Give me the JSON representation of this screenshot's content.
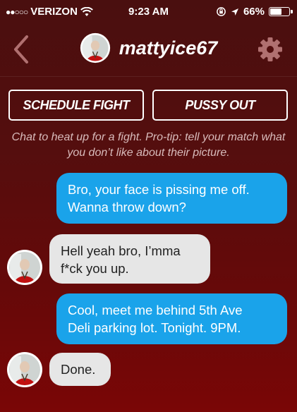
{
  "status": {
    "carrier": "VERIZON",
    "time": "9:23 AM",
    "battery": "66%",
    "battery_level": 0.66,
    "signal_dots": "●●○○○"
  },
  "nav": {
    "username": "mattyice67",
    "back_icon": "chevron-left-icon",
    "settings_icon": "gear-icon"
  },
  "actions": {
    "schedule_label": "SCHEDULE FIGHT",
    "pussy_out_label": "PUSSY OUT"
  },
  "tip": "Chat to heat up for a fight. Pro-tip: tell your match what you don’t like about their picture.",
  "messages": [
    {
      "from": "me",
      "text_line1": "Bro, your face is pissing me off.",
      "text_line2": "Wanna throw down?"
    },
    {
      "from": "them",
      "text_line1": "Hell yeah bro, I’mma",
      "text_line2": "f*ck you up."
    },
    {
      "from": "me",
      "text_line1": "Cool, meet me behind 5th Ave",
      "text_line2": "Deli parking lot. Tonight. 9PM."
    },
    {
      "from": "them",
      "text_line1": "Done.",
      "text_line2": ""
    }
  ],
  "colors": {
    "sent_bubble": "#1aa3ea",
    "received_bubble": "#e6e6e6",
    "background_top": "#4a0f0f",
    "background_bottom": "#7a0606"
  }
}
